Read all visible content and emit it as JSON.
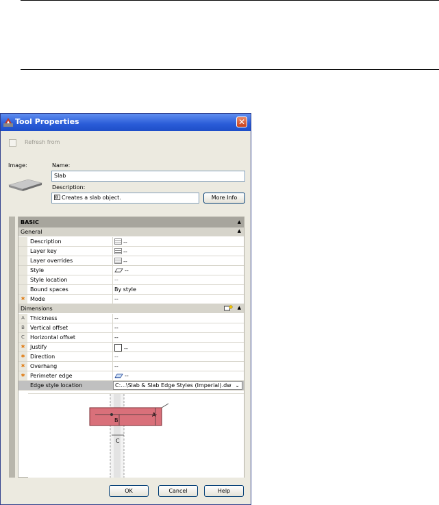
{
  "dialog": {
    "title": "Tool Properties",
    "close_symbol": "✕",
    "refresh_label": "Refresh from",
    "image_label": "Image:",
    "name_label": "Name:",
    "name_value": "Slab",
    "description_label": "Description:",
    "description_value": "Creates a slab object.",
    "more_info_button": "More Info",
    "ok_button": "OK",
    "cancel_button": "Cancel",
    "help_button": "Help"
  },
  "grid": {
    "category": "BASIC",
    "groups": [
      {
        "label": "General",
        "rows": [
          {
            "marker": "",
            "name": "Description",
            "value": "--",
            "icon": "list-icon"
          },
          {
            "marker": "",
            "name": "Layer key",
            "value": "--",
            "icon": "list-icon"
          },
          {
            "marker": "",
            "name": "Layer overrides",
            "value": "--",
            "icon": "list-icon"
          },
          {
            "marker": "",
            "name": "Style",
            "value": "--",
            "icon": "slab-style-icon"
          },
          {
            "marker": "",
            "name": "Style location",
            "value": "--",
            "icon": ""
          },
          {
            "marker": "",
            "name": "Bound spaces",
            "value": "By style",
            "icon": ""
          },
          {
            "marker": "asterisk",
            "name": "Mode",
            "value": "--",
            "icon": ""
          }
        ]
      },
      {
        "label": "Dimensions",
        "rows": [
          {
            "marker": "A",
            "name": "Thickness",
            "value": "--",
            "icon": ""
          },
          {
            "marker": "B",
            "name": "Vertical offset",
            "value": "--",
            "icon": ""
          },
          {
            "marker": "C",
            "name": "Horizontal offset",
            "value": "--",
            "icon": ""
          },
          {
            "marker": "asterisk",
            "name": "Justify",
            "value": "--",
            "icon": "justify-icon"
          },
          {
            "marker": "asterisk",
            "name": "Direction",
            "value": "--",
            "icon": ""
          },
          {
            "marker": "asterisk",
            "name": "Overhang",
            "value": "--",
            "icon": ""
          },
          {
            "marker": "asterisk",
            "name": "Perimeter edge",
            "value": "--",
            "icon": "edge-icon"
          },
          {
            "marker": "",
            "name": "Edge style location",
            "value": "C:...\\Slab & Slab Edge Styles (Imperial).dwg",
            "icon": "",
            "selected": true
          }
        ]
      }
    ],
    "diagram_labels": {
      "a": "A",
      "b": "B",
      "c": "C"
    }
  },
  "colors": {
    "title_bar": "#2a5cd8",
    "dialog_bg": "#eceae0",
    "slab_fill": "#d9707a",
    "asterisk": "#e07a10"
  }
}
